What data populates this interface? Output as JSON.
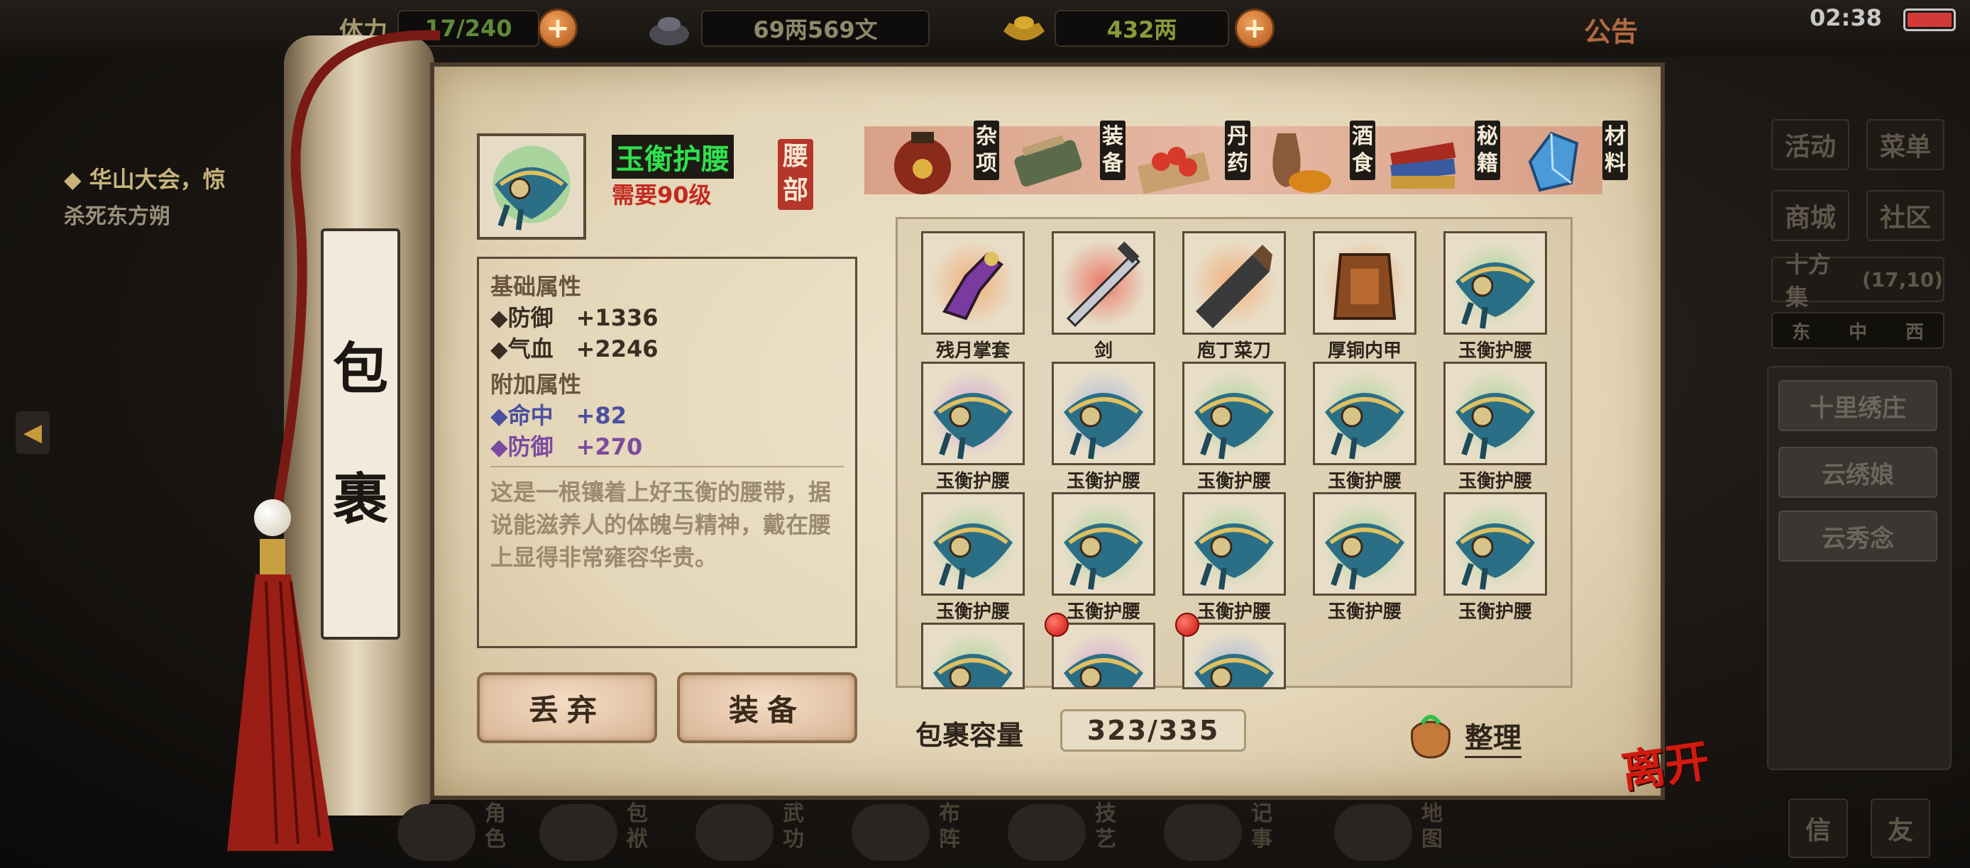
{
  "topbar": {
    "stamina_label": "体力",
    "stamina_value": "17/240",
    "money": "69两569文",
    "gold": "432两",
    "notice": "公告",
    "clock": "02:38"
  },
  "quest": {
    "title": "◆ 华山大会，惊",
    "subtitle": "杀死东方朔"
  },
  "side_menu": {
    "activity": "活动",
    "menu": "菜单",
    "shop": "商城",
    "community": "社区",
    "location": "十方集",
    "coords": "(17,10)",
    "compass": [
      "东",
      "中",
      "西"
    ],
    "npcs": [
      "十里绣庄",
      "云绣娘",
      "云秀念"
    ]
  },
  "scroll": {
    "title_chars": [
      "包",
      "裹"
    ]
  },
  "item": {
    "name": "玉衡护腰",
    "requirement": "需要90级",
    "slot": [
      "腰",
      "部"
    ],
    "base_header": "基础属性",
    "base_attrs": [
      "◆防御　+1336",
      "◆气血　+2246"
    ],
    "extra_header": "附加属性",
    "extra_attrs": [
      "◆命中　+82",
      "◆防御　+270"
    ],
    "description": "这是一根镶着上好玉衡的腰带，据说能滋养人的体魄与精神，戴在腰上显得非常雍容华贵。"
  },
  "actions": {
    "discard": "丢弃",
    "equip": "装备"
  },
  "categories": [
    {
      "label": [
        "杂",
        "项"
      ],
      "icon": "jar-icon"
    },
    {
      "label": [
        "装",
        "备"
      ],
      "icon": "equipment-icon"
    },
    {
      "label": [
        "丹",
        "药"
      ],
      "icon": "pill-icon"
    },
    {
      "label": [
        "酒",
        "食"
      ],
      "icon": "food-icon"
    },
    {
      "label": [
        "秘",
        "籍"
      ],
      "icon": "book-icon"
    },
    {
      "label": [
        "材",
        "料"
      ],
      "icon": "crystal-icon"
    }
  ],
  "inventory": [
    {
      "name": "残月掌套",
      "icon": "gauntlet-icon",
      "glow": "#f3a060"
    },
    {
      "name": "剑",
      "icon": "sword-icon",
      "glow": "#ea5a4a"
    },
    {
      "name": "庖丁菜刀",
      "icon": "cleaver-icon",
      "glow": "#f3a060"
    },
    {
      "name": "厚铜内甲",
      "icon": "armor-icon",
      "glow": "#f3a060"
    },
    {
      "name": "玉衡护腰",
      "icon": "belt-icon",
      "glow": "#8ed08a"
    },
    {
      "name": "玉衡护腰",
      "icon": "belt-icon",
      "glow": "#c890d8"
    },
    {
      "name": "玉衡护腰",
      "icon": "belt-icon",
      "glow": "#8aa8e0"
    },
    {
      "name": "玉衡护腰",
      "icon": "belt-icon",
      "glow": "#8ed08a"
    },
    {
      "name": "玉衡护腰",
      "icon": "belt-icon",
      "glow": "#8ed08a"
    },
    {
      "name": "玉衡护腰",
      "icon": "belt-icon",
      "glow": "#8ed08a"
    },
    {
      "name": "玉衡护腰",
      "icon": "belt-icon",
      "glow": "#8ed08a"
    },
    {
      "name": "玉衡护腰",
      "icon": "belt-icon",
      "glow": "#8ed08a"
    },
    {
      "name": "玉衡护腰",
      "icon": "belt-icon",
      "glow": "#8ed08a"
    },
    {
      "name": "玉衡护腰",
      "icon": "belt-icon",
      "glow": "#8ed08a"
    },
    {
      "name": "玉衡护腰",
      "icon": "belt-icon",
      "glow": "#8ed08a"
    },
    {
      "name": "",
      "icon": "belt-icon",
      "glow": "#8ed08a"
    },
    {
      "name": "",
      "icon": "belt-icon",
      "glow": "#c890d8",
      "new": true
    },
    {
      "name": "",
      "icon": "belt-icon",
      "glow": "#8aa8e0",
      "new": true
    }
  ],
  "capacity": {
    "label": "包裹容量",
    "value": "323/335"
  },
  "sort_label": "整理",
  "leave_label": "离开",
  "bottom_nav": [
    {
      "label": [
        "角",
        "色"
      ]
    },
    {
      "label": [
        "包",
        "袱"
      ]
    },
    {
      "label": [
        "武",
        "功"
      ]
    },
    {
      "label": [
        "布",
        "阵"
      ]
    },
    {
      "label": [
        "技",
        "艺"
      ]
    },
    {
      "label": [
        "记",
        "事"
      ]
    },
    {
      "label": [
        "地",
        "图"
      ]
    }
  ],
  "bottom_right": [
    "信",
    "友"
  ],
  "colors": {
    "name_green": "#2fe04a",
    "requirement_red": "#c32a20",
    "extra_blue": "#4b4fa0",
    "extra_purple": "#7c4aa0"
  }
}
